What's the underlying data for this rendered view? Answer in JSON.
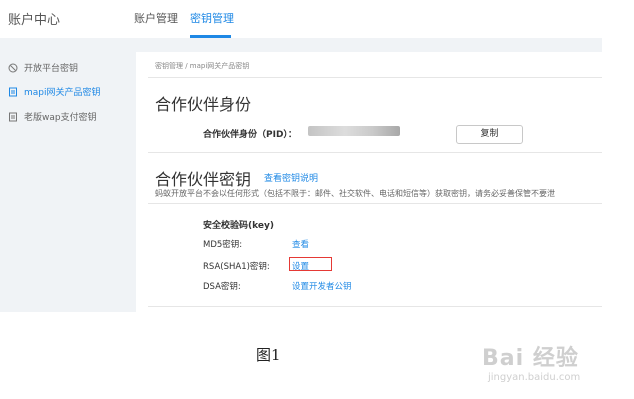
{
  "header": {
    "title": "账户中心",
    "tabs": [
      {
        "label": "账户管理"
      },
      {
        "label": "密钥管理"
      }
    ]
  },
  "sidebar": {
    "items": [
      {
        "label": "开放平台密钥",
        "icon": "power-icon"
      },
      {
        "label": "mapi网关产品密钥",
        "icon": "doc-icon"
      },
      {
        "label": "老版wap支付密钥",
        "icon": "doc-icon"
      }
    ]
  },
  "breadcrumb": {
    "text": "密钥管理 / mapi网关产品密钥"
  },
  "partner_identity": {
    "heading": "合作伙伴身份",
    "pid_label": "合作伙伴身份（PID）：",
    "copy_button": "复制"
  },
  "partner_key": {
    "heading": "合作伙伴密钥",
    "view_link": "查看密钥说明",
    "notice": "蚂蚁开放平台不会以任何形式（包括不限于：邮件、社交软件、电话和短信等）获取密钥，请务必妥善保管不要泄"
  },
  "keys": {
    "title": "安全校验码(key)",
    "rows": [
      {
        "label": "MD5密钥:",
        "action": "查看"
      },
      {
        "label": "RSA(SHA1)密钥:",
        "action": "设置"
      },
      {
        "label": "DSA密钥:",
        "action": "设置开发者公钥"
      }
    ]
  },
  "caption": "图1",
  "watermark": {
    "main": "Bai 经验",
    "sub": "jingyan.baidu.com"
  },
  "colors": {
    "accent": "#1e88e5",
    "highlight": "#e53935",
    "sidebar_bg": "#f0f3f6"
  }
}
